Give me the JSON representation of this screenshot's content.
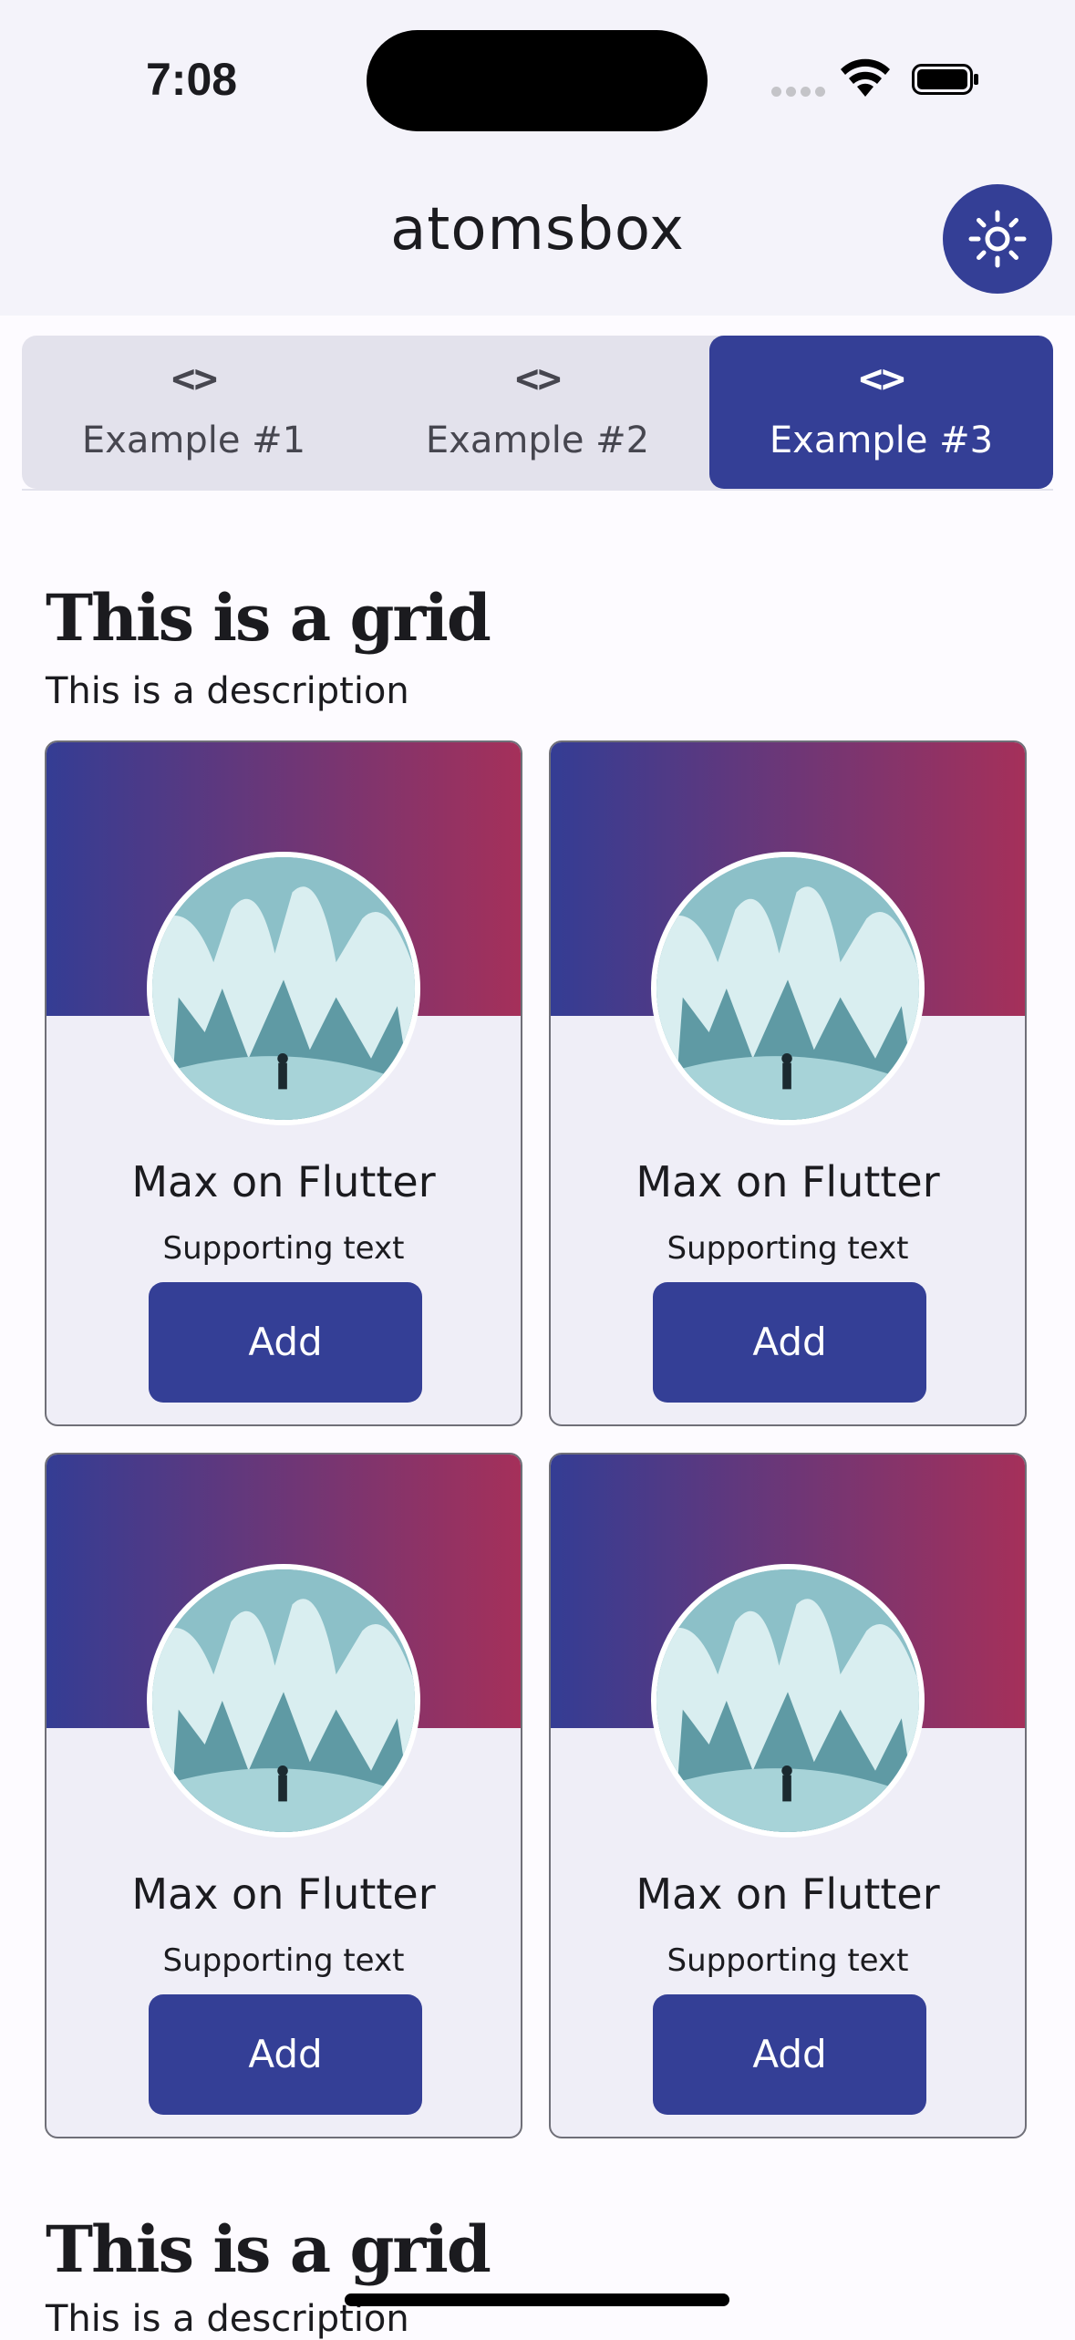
{
  "status_bar": {
    "time": "7:08"
  },
  "app_bar": {
    "title": "atomsbox",
    "theme_toggle_icon": "sun-icon"
  },
  "tabs": [
    {
      "label": "Example #1",
      "icon": "code-icon",
      "glyph": "<>",
      "active": false
    },
    {
      "label": "Example #2",
      "icon": "code-icon",
      "glyph": "<>",
      "active": false
    },
    {
      "label": "Example #3",
      "icon": "code-icon",
      "glyph": "<>",
      "active": true
    }
  ],
  "sections": [
    {
      "title": "This is a grid",
      "description": "This is a description",
      "cards": [
        {
          "title": "Max on Flutter",
          "subtitle": "Supporting text",
          "button": "Add"
        },
        {
          "title": "Max on Flutter",
          "subtitle": "Supporting text",
          "button": "Add"
        },
        {
          "title": "Max on Flutter",
          "subtitle": "Supporting text",
          "button": "Add"
        },
        {
          "title": "Max on Flutter",
          "subtitle": "Supporting text",
          "button": "Add"
        }
      ]
    },
    {
      "title": "This is a grid",
      "description": "This is a description"
    }
  ],
  "colors": {
    "primary": "#343f96",
    "gradient_start": "#343d94",
    "gradient_end": "#a5305a",
    "surface": "#efeef7",
    "background": "#fdfbff"
  }
}
